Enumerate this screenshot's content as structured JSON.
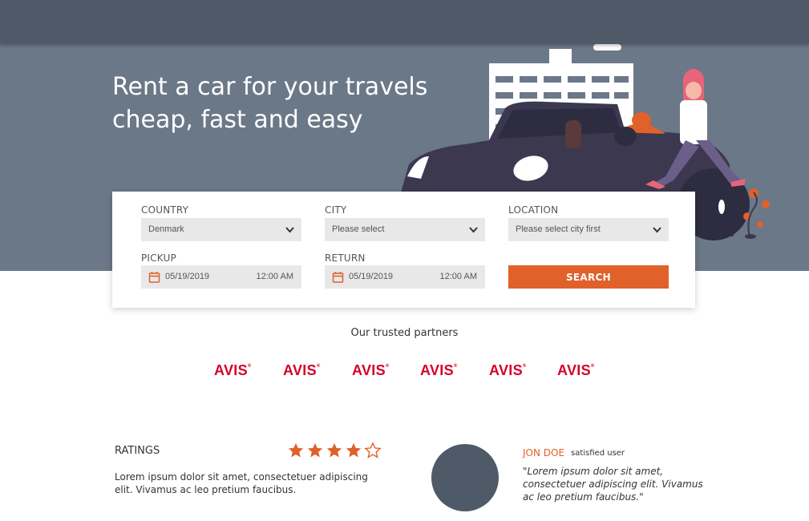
{
  "hero": {
    "headline_line1": "Rent a car for your travels",
    "headline_line2": "cheap, fast and easy"
  },
  "search": {
    "country": {
      "label": "COUNTRY",
      "value": "Denmark"
    },
    "city": {
      "label": "CITY",
      "value": "Please select"
    },
    "location": {
      "label": "LOCATION",
      "value": "Please select city first"
    },
    "pickup": {
      "label": "PICKUP",
      "date": "05/19/2019",
      "time": "12:00 AM"
    },
    "return": {
      "label": "RETURN",
      "date": "05/19/2019",
      "time": "12:00 AM"
    },
    "button_label": "SEARCH"
  },
  "partners": {
    "title": "Our trusted partners",
    "logos": [
      "AVIS",
      "AVIS",
      "AVIS",
      "AVIS",
      "AVIS",
      "AVIS"
    ]
  },
  "ratings": {
    "title": "RATINGS",
    "stars_filled": 4,
    "stars_total": 5,
    "text": "Lorem ipsum dolor sit amet, consectetuer adipiscing elit. Vivamus ac leo pretium faucibus."
  },
  "review": {
    "name": "JON DOE",
    "role": "satisfied user",
    "quote": "\"Lorem ipsum dolor sit amet, consectetuer adipiscing elit. Vivamus ac leo pretium faucibus.\""
  },
  "colors": {
    "accent": "#e0612a",
    "header": "#4f5a68",
    "hero": "#6b7888",
    "brand_logo": "#d4002a"
  }
}
